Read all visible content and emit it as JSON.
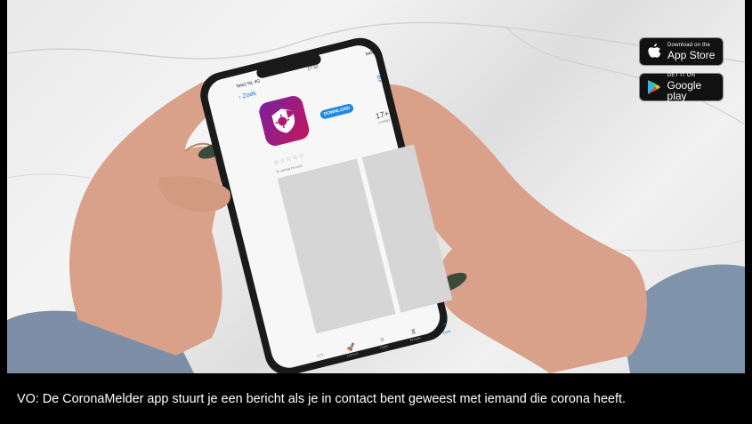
{
  "badges": {
    "appstore": {
      "small": "Download on the",
      "big": "App Store"
    },
    "googleplay": {
      "small": "GET IT ON",
      "big": "Google play"
    }
  },
  "phone": {
    "status_carrier": "Tele2 NL  4G",
    "status_time": "17:32",
    "status_battery": "54%",
    "back_label": "Zoek",
    "download_label": "DOWNLOAD",
    "age_rating": "17+",
    "age_sub": "Leeftijd",
    "stars": "☆☆☆☆☆",
    "no_ratings": "Te weinig beoord.",
    "tabs": [
      {
        "icon": "▭",
        "label": ""
      },
      {
        "icon": "🚀",
        "label": "Games"
      },
      {
        "icon": "≡",
        "label": "Apps"
      },
      {
        "icon": "♜",
        "label": "Arcade"
      },
      {
        "icon": "⌕",
        "label": "Zoek"
      }
    ]
  },
  "caption": "VO: De CoronaMelder app stuurt je een bericht als je in contact bent geweest met iemand die corona heeft.",
  "colors": {
    "app_icon": "#a01b7e",
    "download": "#1e88e5",
    "caption_bg": "#000000"
  }
}
